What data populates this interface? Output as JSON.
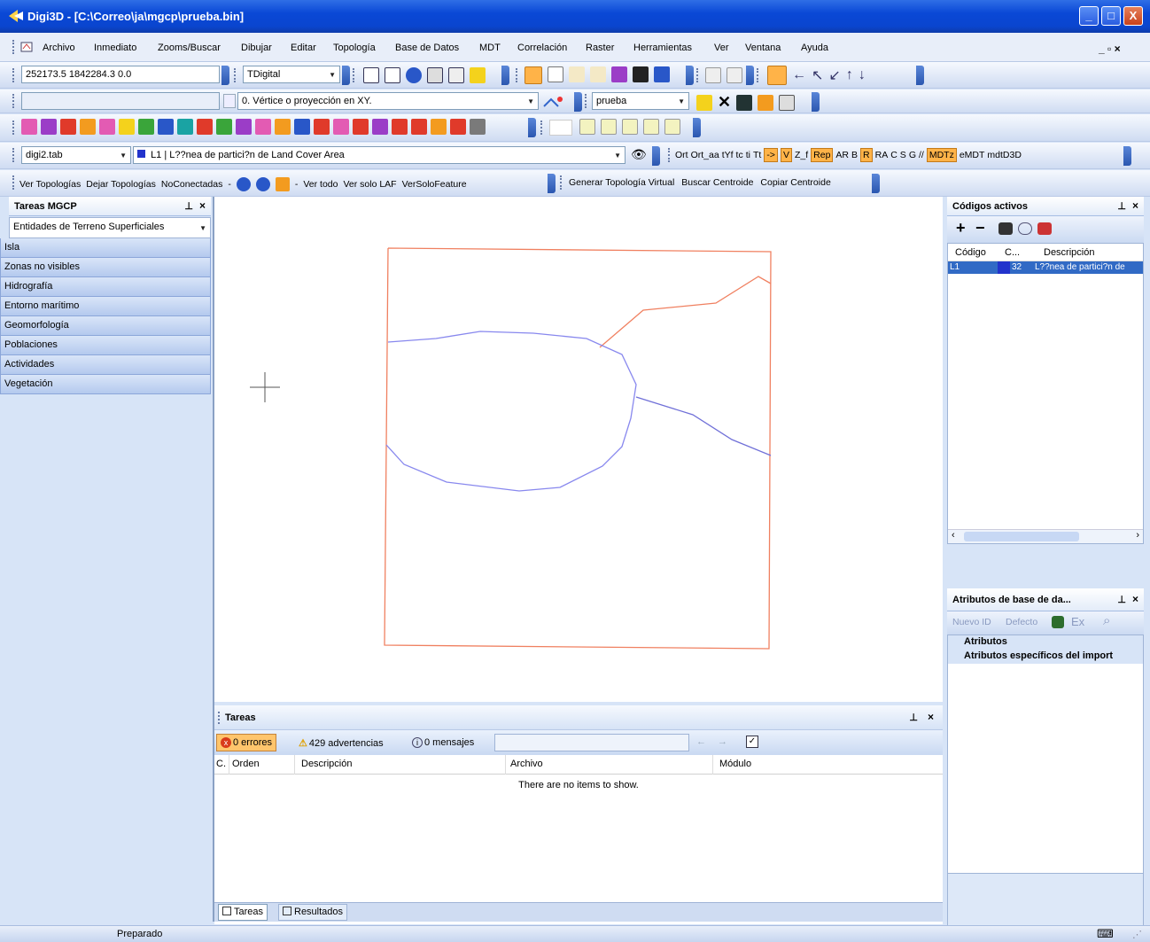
{
  "window": {
    "title": "Digi3D - [C:\\Correo\\ja\\mgcp\\prueba.bin]",
    "min": "_",
    "max": "□",
    "close": "X"
  },
  "menu": {
    "items": [
      "Archivo",
      "Inmediato",
      "Zooms/Buscar",
      "Dibujar",
      "Editar",
      "Topología",
      "Base de Datos",
      "MDT",
      "Correlación",
      "Raster",
      "Herramientas",
      "Ver",
      "Ventana",
      "Ayuda"
    ],
    "mdi_controls": "_ ▫ ×"
  },
  "toolbar": {
    "coords": "252173.5 1842284.3   0.0",
    "mode": "TDigital",
    "snap_mode": "0. Vértice o proyección en XY.",
    "file": "prueba",
    "tab_file": "digi2.tab",
    "code_combo": "L1 | L??nea de partici?n de Land Cover Area",
    "right_labels": [
      "Ort",
      "Ort_aa",
      "tYf",
      "tc",
      "ti",
      "Tt",
      "->",
      "V",
      "Z_f",
      "Rep",
      "AR",
      "B",
      "R",
      "RA",
      "C",
      "S",
      "G",
      "//",
      "MDTz",
      "eMDT",
      "mdtD3D"
    ],
    "topo_labels": [
      "Ver Topologías",
      "Dejar Topologías",
      "NoConectadas",
      "-",
      "Ver todo",
      "Ver solo LAF",
      "VerSoloFeature"
    ],
    "virtual_labels": [
      "Generar Topología Virtual",
      "Buscar Centroide",
      "Copiar Centroide"
    ]
  },
  "left_panel": {
    "title": "Tareas MGCP",
    "combo": "Entidades de Terreno Superficiales",
    "categories": [
      "Isla",
      "Zonas no visibles",
      "Hidrografía",
      "Entorno marítimo",
      "Geomorfología",
      "Poblaciones",
      "Actividades",
      "Vegetación"
    ]
  },
  "tasks_panel": {
    "title": "Tareas",
    "errors": "0 errores",
    "warnings": "429 advertencias",
    "messages": "0 mensajes",
    "columns": [
      "C.",
      "Orden",
      "Descripción",
      "Archivo",
      "Módulo"
    ],
    "empty_text": "There are no items to show.",
    "bottom_tabs": [
      "Tareas",
      "Resultados"
    ]
  },
  "codes_panel": {
    "title": "Códigos activos",
    "columns": [
      "Código",
      "C...",
      "Descripción"
    ],
    "rows": [
      {
        "code": "L1",
        "c": "32",
        "desc": "L??nea de partici?n de"
      }
    ]
  },
  "attr_panel": {
    "title": "Atributos de base de da...",
    "buttons": [
      "Nuevo ID",
      "Defecto",
      "Ex"
    ],
    "items": [
      "Atributos",
      "Atributos específicos del import"
    ]
  },
  "statusbar": {
    "text": "Preparado"
  },
  "colors": {
    "boundary": "#f08060",
    "lines": "#8080e8",
    "accent": "#ffb348"
  }
}
